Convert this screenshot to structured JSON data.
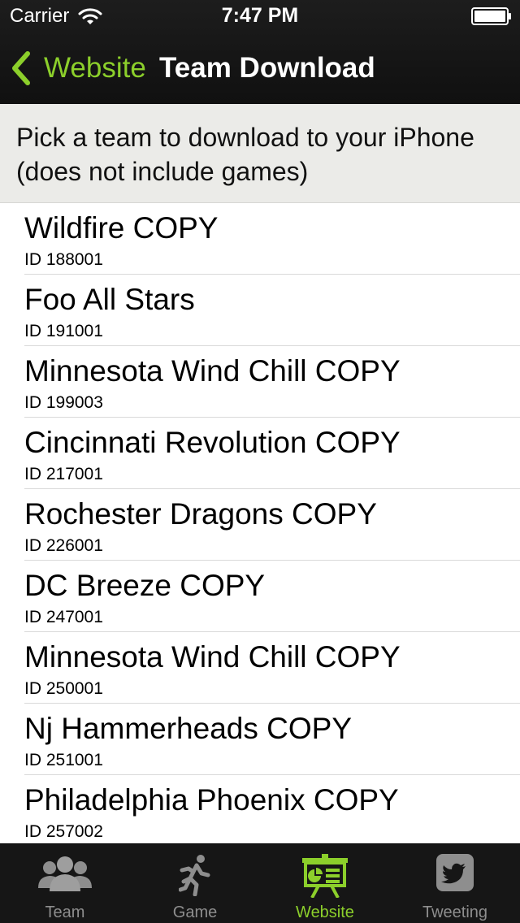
{
  "status_bar": {
    "carrier": "Carrier",
    "time": "7:47 PM"
  },
  "nav": {
    "back_label": "Website",
    "title": "Team Download"
  },
  "instruction": "Pick a team to download to your iPhone (does not include games)",
  "teams": [
    {
      "name": "Wildfire COPY",
      "id": "ID 188001"
    },
    {
      "name": "Foo All Stars",
      "id": "ID 191001"
    },
    {
      "name": "Minnesota Wind Chill COPY",
      "id": "ID 199003"
    },
    {
      "name": "Cincinnati Revolution COPY",
      "id": "ID 217001"
    },
    {
      "name": "Rochester Dragons COPY",
      "id": "ID 226001"
    },
    {
      "name": "DC Breeze COPY",
      "id": "ID 247001"
    },
    {
      "name": "Minnesota Wind Chill COPY",
      "id": "ID 250001"
    },
    {
      "name": "Nj Hammerheads COPY",
      "id": "ID 251001"
    },
    {
      "name": "Philadelphia Phoenix COPY",
      "id": "ID 257002"
    }
  ],
  "tab_bar": {
    "tabs": [
      {
        "label": "Team",
        "icon": "team-icon",
        "active": false
      },
      {
        "label": "Game",
        "icon": "runner-icon",
        "active": false
      },
      {
        "label": "Website",
        "icon": "presentation-board-icon",
        "active": true
      },
      {
        "label": "Tweeting",
        "icon": "twitter-bird-icon",
        "active": false
      }
    ]
  },
  "colors": {
    "accent": "#8ccf2b",
    "nav_background": "#161616",
    "instruction_background": "#ebebe8",
    "inactive_tab": "#8e8e8e"
  }
}
